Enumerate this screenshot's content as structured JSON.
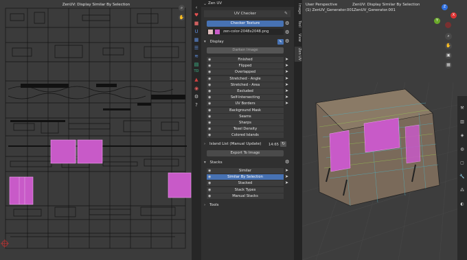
{
  "uv_editor": {
    "title": "ZenUV: Display Similar By Selection",
    "tools": {
      "zoom": "zoom-icon",
      "hand": "hand-icon"
    }
  },
  "side_tabs": [
    "heart-icon",
    "cube-icon",
    "uv-icon",
    "grid-icon",
    "layers-icon",
    "td-icon",
    "stack-icon",
    "gear-icon",
    "help-icon"
  ],
  "panel": {
    "header": "Zen UV",
    "checker": {
      "title": "UV Checker",
      "checker_texture": "Checker Texture",
      "image": "zen-color-2048x2048.png"
    },
    "display": {
      "title": "Display",
      "darken_image": "Darken Image",
      "items": [
        "Finished",
        "Flipped",
        "Overlapped",
        "Stretched - Angle",
        "Stretched - Area",
        "Excluded",
        "Self-Intersecting",
        "UV Borders",
        "Background Mask",
        "Seams",
        "Sharps",
        "Texel Density",
        "Colored Islands"
      ]
    },
    "island_list": {
      "label": "Island List (Manual Update)",
      "count": "14:65"
    },
    "export": "Export To Image",
    "stacks": {
      "title": "Stacks",
      "items": [
        "Similar",
        "Similar By Selection",
        "Stacked",
        "Stack Types",
        "Manual Stacks"
      ],
      "selected": "Similar By Selection"
    },
    "tools": "Tools"
  },
  "vertical_tabs": [
    "Image",
    "Tool",
    "View",
    "Zen UV"
  ],
  "viewport": {
    "perspective": "User Perspective",
    "object": "(1) ZenUV_Generator.001",
    "title": "ZenUV: Display Similar By Selection",
    "object_right": "ZenUV_Generator.001",
    "gizmo": {
      "x": "X",
      "y": "Y",
      "z": "Z"
    }
  },
  "colors": {
    "accent": "#4772b3",
    "highlight_islands": "#c85ac8",
    "background": "#3a3a3a"
  }
}
